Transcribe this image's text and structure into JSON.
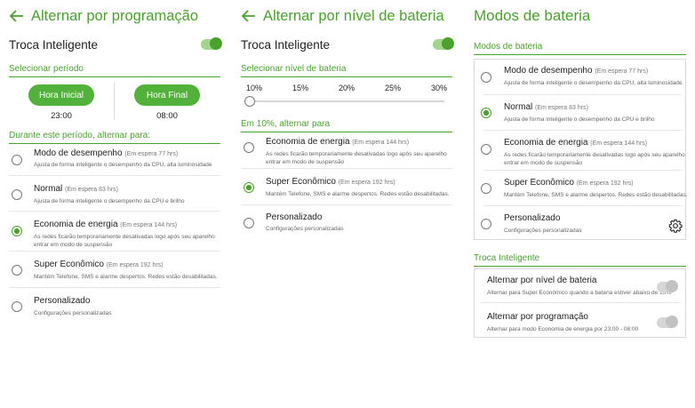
{
  "panel1": {
    "title": "Alternar por programação",
    "master_label": "Troca Inteligente",
    "master_on": true,
    "section_period": "Selecionar período",
    "start_label": "Hora Inicial",
    "start_time": "23:00",
    "end_label": "Hora Final",
    "end_time": "08:00",
    "section_switch": "Durante este período, alternar para:",
    "options": [
      {
        "title": "Modo de desempenho",
        "standby": "(Em espera 77 hrs)",
        "desc": [
          "Ajusta de forma inteligente o desempenho da CPU, alta luminosidade"
        ],
        "selected": false
      },
      {
        "title": "Normal",
        "standby": "(Em espera 83 hrs)",
        "desc": [
          "Ajusta de forma inteligente o desempenho da CPU e brilho"
        ],
        "selected": false
      },
      {
        "title": "Economia de energia",
        "standby": "(Em espera 144 hrs)",
        "desc": [
          "As redes ficarão temporariamente desativadas logo após seu aparelho",
          "entrar em modo de suspensão"
        ],
        "selected": true
      },
      {
        "title": "Super Econômico",
        "standby": "(Em espera 192 hrs)",
        "desc": [
          "Mantém Telefone, SMS e alarme despertos. Redes estão desabilitadas."
        ],
        "selected": false
      },
      {
        "title": "Personalizado",
        "standby": "",
        "desc": [
          "Configurações personalizadas"
        ],
        "selected": false
      }
    ]
  },
  "panel2": {
    "title": "Alternar por nível de bateria",
    "master_label": "Troca Inteligente",
    "master_on": true,
    "section_level": "Selecionar nível de bateria",
    "ticks": [
      "10%",
      "15%",
      "20%",
      "25%",
      "30%"
    ],
    "slider_value": "10%",
    "section_switch": "Em 10%, alternar para",
    "options": [
      {
        "title": "Economia de energia",
        "standby": "(Em espera 144 hrs)",
        "desc": [
          "As redes ficarão temporariamente desativadas logo após seu aparelho",
          "entrar em modo de suspensão"
        ],
        "selected": false
      },
      {
        "title": "Super Econômico",
        "standby": "(Em espera 192 hrs)",
        "desc": [
          "Mantém Telefone, SMS e alarme despertos. Redes estão desabilitadas."
        ],
        "selected": true
      },
      {
        "title": "Personalizado",
        "standby": "",
        "desc": [
          "Configurações personalizadas"
        ],
        "selected": false
      }
    ]
  },
  "panel3": {
    "title": "Modos de bateria",
    "section_modes": "Modos de bateria",
    "options": [
      {
        "title": "Modo de desempenho",
        "standby": "(Em espera 77 hrs)",
        "desc": [
          "Ajusta de forma inteligente o desempenho da CPU, alta luminosidade"
        ],
        "selected": false
      },
      {
        "title": "Normal",
        "standby": "(Em espera 83 hrs)",
        "desc": [
          "Ajusta de forma inteligente o desempenho da CPU e brilho"
        ],
        "selected": true
      },
      {
        "title": "Economia de energia",
        "standby": "(Em espera 144 hrs)",
        "desc": [
          "As redes ficarão temporariamente desativadas logo após seu aparelho",
          "entrar em modo de suspensão"
        ],
        "selected": false
      },
      {
        "title": "Super Econômico",
        "standby": "(Em espera 192 hrs)",
        "desc": [
          "Mantém Telefone, SMS e alarme despertos. Redes estão desabilitadas."
        ],
        "selected": false
      },
      {
        "title": "Personalizado",
        "standby": "",
        "desc": [
          "Configurações personalizadas"
        ],
        "selected": false
      }
    ],
    "section_smart": "Troca Inteligente",
    "smart_items": [
      {
        "title": "Alternar por nível de bateria",
        "desc": "Alternar para Super Econômico quando a bateria estiver abaixo de 10%",
        "on": false
      },
      {
        "title": "Alternar por programação",
        "desc": "Alternar para modo Economia de energia por 23:00 - 08:00",
        "on": false
      }
    ]
  },
  "colors": {
    "accent": "#4aa12e",
    "button": "#52b13a"
  },
  "icons": {
    "back": "arrow-left-icon",
    "settings": "gear-icon"
  }
}
